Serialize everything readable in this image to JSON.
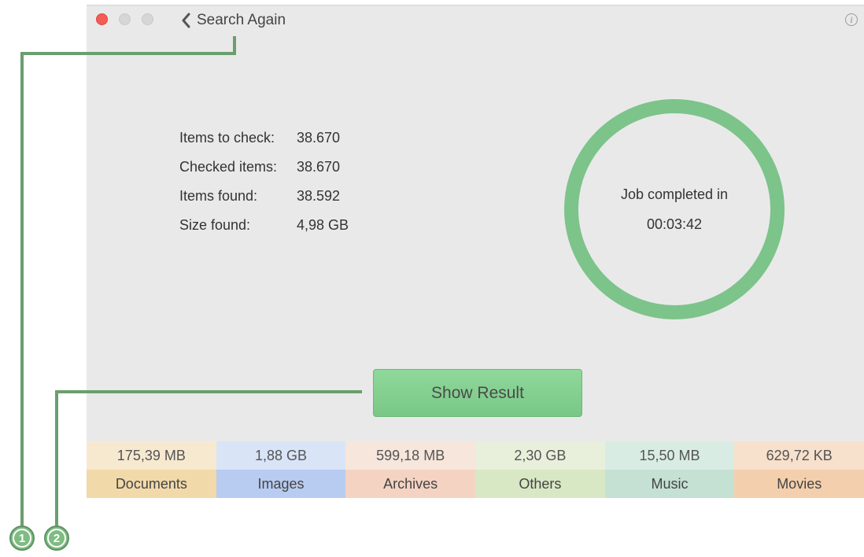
{
  "toolbar": {
    "back_label": "Search Again",
    "info_icon": "i"
  },
  "stats": [
    {
      "label": "Items to check:",
      "value": "38.670"
    },
    {
      "label": "Checked items:",
      "value": "38.670"
    },
    {
      "label": "Items found:",
      "value": "38.592"
    },
    {
      "label": "Size found:",
      "value": "4,98 GB"
    }
  ],
  "status": {
    "line1": "Job completed in",
    "time": "00:03:42",
    "progress_fraction": 1.0,
    "ring_color": "#7cc48a"
  },
  "actions": {
    "show_result_label": "Show Result"
  },
  "categories": [
    {
      "size": "175,39 MB",
      "name": "Documents",
      "size_bg": "#f7e9d0",
      "name_bg": "#f2d9a9"
    },
    {
      "size": "1,88 GB",
      "name": "Images",
      "size_bg": "#d9e4f7",
      "name_bg": "#b8cbf0"
    },
    {
      "size": "599,18 MB",
      "name": "Archives",
      "size_bg": "#f7e6dc",
      "name_bg": "#f4d3c2"
    },
    {
      "size": "2,30 GB",
      "name": "Others",
      "size_bg": "#e8f0dc",
      "name_bg": "#d8e8c4"
    },
    {
      "size": "15,50 MB",
      "name": "Music",
      "size_bg": "#d9ece4",
      "name_bg": "#c4e1d3"
    },
    {
      "size": "629,72 KB",
      "name": "Movies",
      "size_bg": "#f7e0cc",
      "name_bg": "#f4cfad"
    }
  ],
  "callouts": [
    {
      "number": "1"
    },
    {
      "number": "2"
    }
  ]
}
